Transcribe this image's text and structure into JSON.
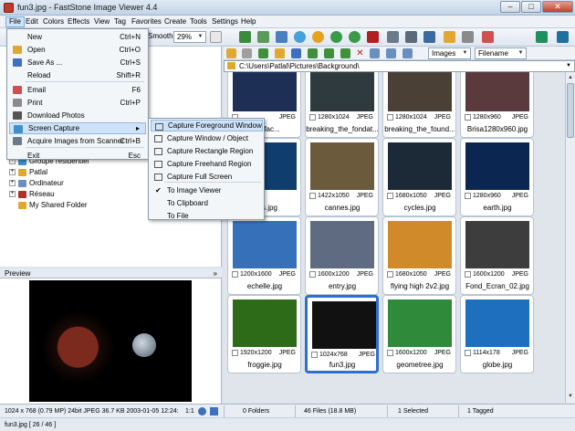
{
  "window": {
    "title": "fun3.jpg - FastStone Image Viewer 4.4",
    "minimize": "–",
    "maximize": "□",
    "close": "✕"
  },
  "menubar": [
    "File",
    "Edit",
    "Colors",
    "Effects",
    "View",
    "Tag",
    "Favorites",
    "Create",
    "Tools",
    "Settings",
    "Help"
  ],
  "toolbar": {
    "smooth_label": "Smooth",
    "zoom_value": "29%",
    "view_filter": "Images",
    "sort_by": "Filename"
  },
  "file_menu": [
    {
      "label": "New",
      "shortcut": "Ctrl+N",
      "icon": "none"
    },
    {
      "label": "Open",
      "shortcut": "Ctrl+O",
      "icon": "folder-open-icon"
    },
    {
      "label": "Save As ...",
      "shortcut": "Ctrl+S",
      "icon": "save-icon"
    },
    {
      "label": "Reload",
      "shortcut": "Shift+R",
      "icon": "none"
    },
    {
      "label": "Email",
      "shortcut": "F6",
      "icon": "email-icon"
    },
    {
      "label": "Print",
      "shortcut": "Ctrl+P",
      "icon": "print-icon"
    },
    {
      "label": "Download Photos",
      "shortcut": "",
      "icon": "camera-icon"
    },
    {
      "label": "Screen Capture",
      "shortcut": "",
      "icon": "screen-icon",
      "submenu_arrow": "▸"
    },
    {
      "label": "Acquire Images from Scanner",
      "shortcut": "Ctrl+B",
      "icon": "scanner-icon"
    },
    {
      "label": "Exit",
      "shortcut": "Esc",
      "icon": "none"
    }
  ],
  "capture_menu": [
    {
      "label": "Capture Foreground Window"
    },
    {
      "label": "Capture Window / Object"
    },
    {
      "label": "Capture Rectangle Region"
    },
    {
      "label": "Capture Freehand Region"
    },
    {
      "label": "Capture Full Screen"
    },
    {
      "label": "To Image Viewer",
      "check": "✔"
    },
    {
      "label": "To Clipboard"
    },
    {
      "label": "To File"
    }
  ],
  "folder_tree": [
    "Groupe résidentiel",
    "Patlal",
    "Ordinateur",
    "Réseau",
    "My Shared Folder"
  ],
  "preview": {
    "header": "Preview",
    "collapse": "»"
  },
  "address_path": "C:\\Users\\Patlal\\Pictures\\Background\\",
  "thumbnails": [
    {
      "name": "Interfac...",
      "res": "",
      "fmt": "JPEG",
      "color": "#1d2f55"
    },
    {
      "name": "breaking_the_fondat...",
      "res": "1280x1024",
      "fmt": "JPEG",
      "color": "#2e3a3e"
    },
    {
      "name": "breaking_the_found...",
      "res": "1280x1024",
      "fmt": "JPEG",
      "color": "#4a4035"
    },
    {
      "name": "Brisa1280x960.jpg",
      "res": "1280x960",
      "fmt": "JPEG",
      "color": "#5a3a3d"
    },
    {
      "name": "...es.jpg",
      "res": "",
      "fmt": "",
      "color": "#0f3d6e"
    },
    {
      "name": "cannes.jpg",
      "res": "1422x1050",
      "fmt": "JPEG",
      "color": "#6b5a3c"
    },
    {
      "name": "cycles.jpg",
      "res": "1680x1050",
      "fmt": "JPEG",
      "color": "#1b2a36"
    },
    {
      "name": "earth.jpg",
      "res": "1280x960",
      "fmt": "JPEG",
      "color": "#0b2650"
    },
    {
      "name": "echelle.jpg",
      "res": "1200x1600",
      "fmt": "JPEG",
      "color": "#3670b8"
    },
    {
      "name": "entry.jpg",
      "res": "1600x1200",
      "fmt": "JPEG",
      "color": "#5e6b80"
    },
    {
      "name": "flying high 2v2.jpg",
      "res": "1680x1050",
      "fmt": "JPEG",
      "color": "#d08a2a"
    },
    {
      "name": "Fond_Ecran_02.jpg",
      "res": "1600x1200",
      "fmt": "JPEG",
      "color": "#3d3d3d"
    },
    {
      "name": "froggie.jpg",
      "res": "1920x1200",
      "fmt": "JPEG",
      "color": "#2e6b18"
    },
    {
      "name": "fun3.jpg",
      "res": "1024x768",
      "fmt": "JPEG",
      "color": "#111111"
    },
    {
      "name": "geometree.jpg",
      "res": "1600x1200",
      "fmt": "JPEG",
      "color": "#2f8a3a"
    },
    {
      "name": "globe.jpg",
      "res": "1114x178",
      "fmt": "JPEG",
      "color": "#1f6fbf"
    }
  ],
  "status": {
    "image_info": "1024 x 768 (0.79 MP)  24bit  JPEG  36.7 KB  2003-01-05 12:24:",
    "ratio": "1:1",
    "folders": "0 Folders",
    "files": "46 Files (18.8 MB)",
    "selected": "1 Selected",
    "tagged": "1 Tagged",
    "position": "fun3.jpg [ 26 / 46 ]"
  }
}
